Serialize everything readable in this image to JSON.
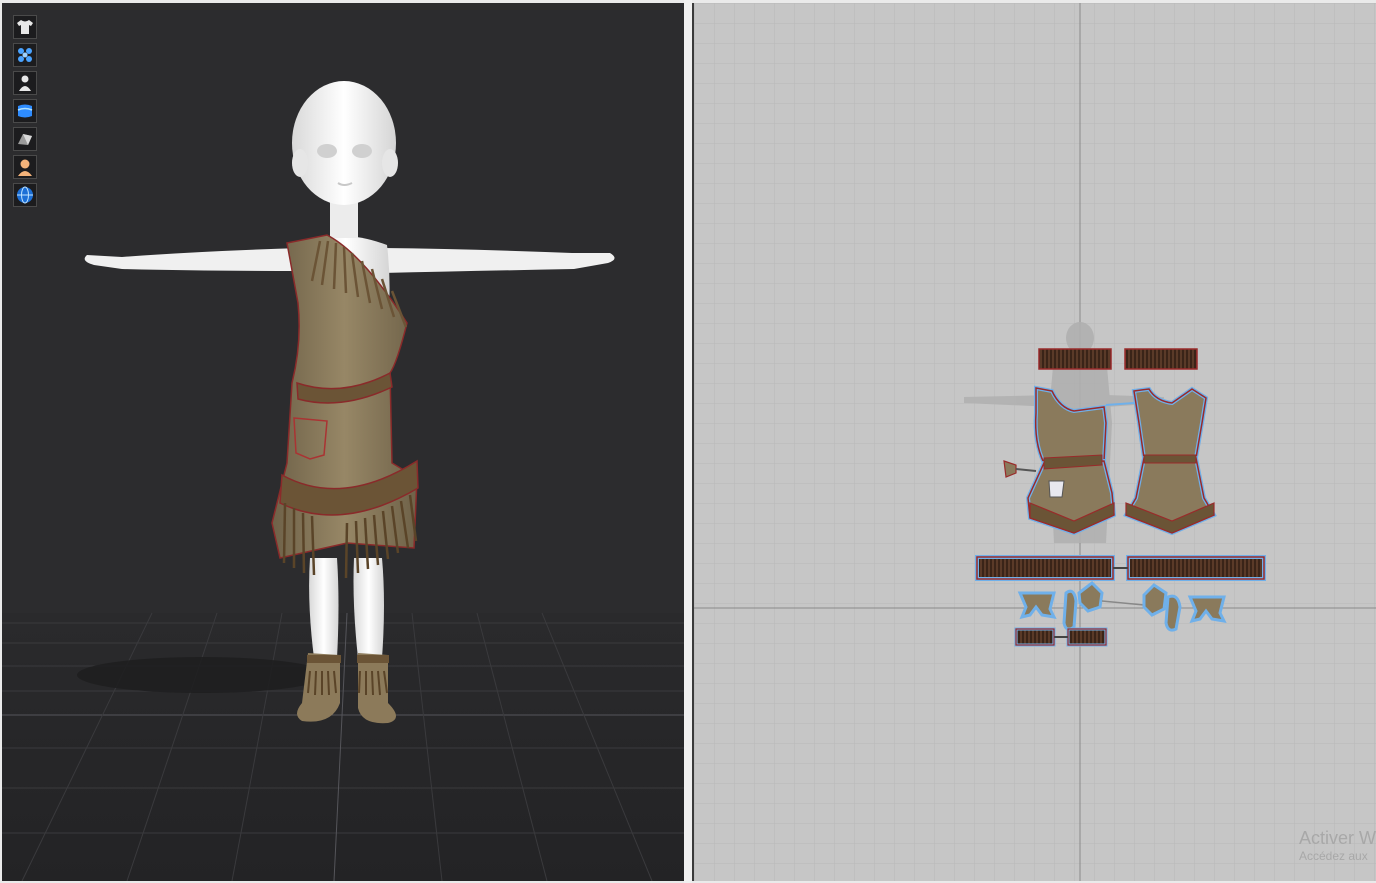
{
  "toolbar": {
    "items": [
      {
        "id": "garment",
        "icon": "shirt-icon"
      },
      {
        "id": "particles",
        "icon": "particle-spheres-icon"
      },
      {
        "id": "avatar",
        "icon": "avatar-icon"
      },
      {
        "id": "fabric",
        "icon": "fabric-icon"
      },
      {
        "id": "texture",
        "icon": "texture-icon"
      },
      {
        "id": "skin",
        "icon": "skin-avatar-icon"
      },
      {
        "id": "environment",
        "icon": "globe-icon"
      }
    ]
  },
  "colors": {
    "viewport_bg": "#2c2c2e",
    "pattern_bg": "#c6c6c6",
    "fabric": "#8a7a5c",
    "fabric_dark": "#6b5436",
    "seam": "#9a2a2a",
    "selection": "#6fb0ea",
    "avatar": "#f2f2f2"
  },
  "watermark": {
    "line1": "Activer W",
    "line2": "Accédez aux"
  }
}
